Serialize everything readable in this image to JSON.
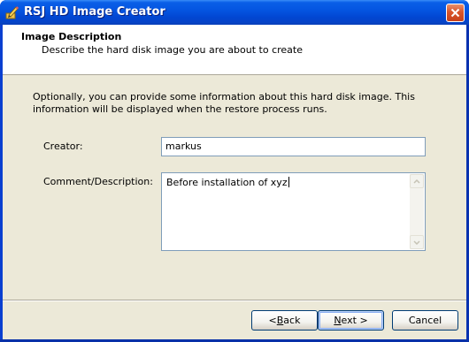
{
  "window": {
    "title": "RSJ HD Image Creator"
  },
  "header": {
    "title": "Image Description",
    "subtitle": "Describe the hard disk image you are about to create"
  },
  "body": {
    "intro": "Optionally, you can provide some information about this hard disk image. This information will be displayed when the restore process runs."
  },
  "form": {
    "creator_label": "Creator:",
    "creator_value": "markus",
    "comment_label": "Comment/Description:",
    "comment_value": "Before installation of xyz"
  },
  "buttons": {
    "back_prefix": "< ",
    "back_mnemonic": "B",
    "back_rest": "ack",
    "next_mnemonic": "N",
    "next_rest": "ext >",
    "cancel": "Cancel"
  },
  "colors": {
    "titlebar": "#0453df",
    "frame": "#ece9d8",
    "close_button": "#d9552b"
  },
  "icons": {
    "app": "pencil-icon",
    "close": "close-icon",
    "scroll_up": "scroll-up-arrow-icon",
    "scroll_down": "scroll-down-arrow-icon"
  }
}
